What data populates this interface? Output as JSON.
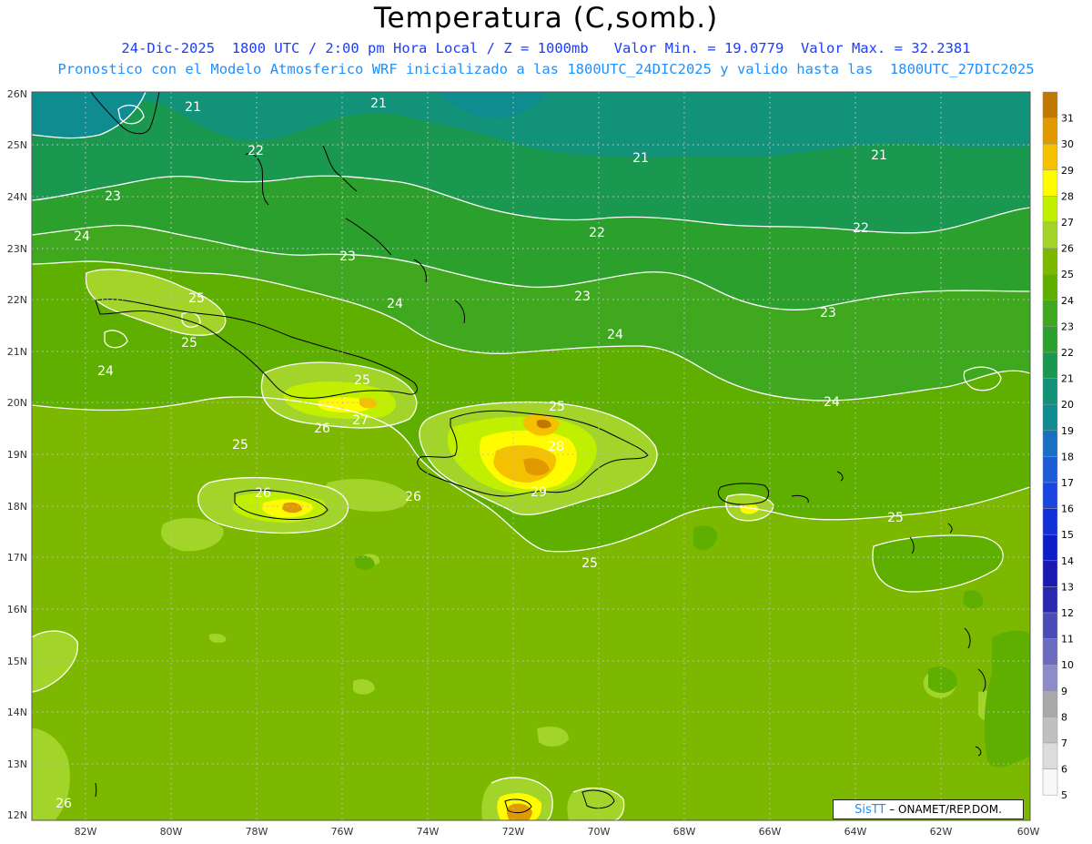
{
  "header": {
    "title": "Temperatura (C,somb.)",
    "subtitle_line1": "24-Dic-2025  1800 UTC / 2:00 pm Hora Local / Z = 1000mb   Valor Min. = 19.0779  Valor Max. = 32.2381",
    "subtitle_line2": "Pronostico con el Modelo Atmosferico WRF inicializado a las 1800UTC_24DIC2025 y valido hasta las  1800UTC_27DIC2025"
  },
  "map": {
    "lon_range": [
      -83.2,
      -60
    ],
    "lat_range": [
      11.9,
      26.1
    ],
    "lat_ticks": [
      "26N",
      "25N",
      "24N",
      "23N",
      "22N",
      "21N",
      "20N",
      "19N",
      "18N",
      "17N",
      "16N",
      "15N",
      "14N",
      "13N",
      "12N"
    ],
    "lon_ticks": [
      "82W",
      "80W",
      "78W",
      "76W",
      "74W",
      "72W",
      "70W",
      "68W",
      "66W",
      "64W",
      "62W",
      "60W"
    ],
    "grid": "dotted",
    "contour_labels": [
      "21",
      "21",
      "21",
      "21",
      "22",
      "22",
      "22",
      "23",
      "23",
      "23",
      "23",
      "24",
      "24",
      "24",
      "24",
      "24",
      "25",
      "25",
      "25",
      "25",
      "25",
      "25",
      "25",
      "26",
      "26",
      "26",
      "26",
      "27",
      "28",
      "29"
    ]
  },
  "colorbar": {
    "labels": [
      "31",
      "30",
      "29",
      "28",
      "27",
      "26",
      "25",
      "24",
      "23",
      "22",
      "21",
      "20",
      "19",
      "18",
      "17",
      "16",
      "15",
      "14",
      "13",
      "12",
      "11",
      "10",
      "9",
      "8",
      "7",
      "6",
      "5"
    ],
    "colors": [
      "#c07800",
      "#e09a00",
      "#f5c000",
      "#fffc00",
      "#c0f000",
      "#a2d42a",
      "#7cb800",
      "#5eaf00",
      "#3fa81e",
      "#2ca02c",
      "#1b9850",
      "#13927a",
      "#0f8c8f",
      "#1a6fc0",
      "#1e5cd8",
      "#1a46e0",
      "#1030d8",
      "#0c1ec8",
      "#1a1ab0",
      "#2828b0",
      "#4c4cb8",
      "#6a6abf",
      "#8c8cc8",
      "#a8a8a8",
      "#c0c0c0",
      "#dcdcdc",
      "#f8f8f8"
    ]
  },
  "credit": {
    "brand": "SisTT",
    "text": "– ONAMET/REP.DOM."
  }
}
